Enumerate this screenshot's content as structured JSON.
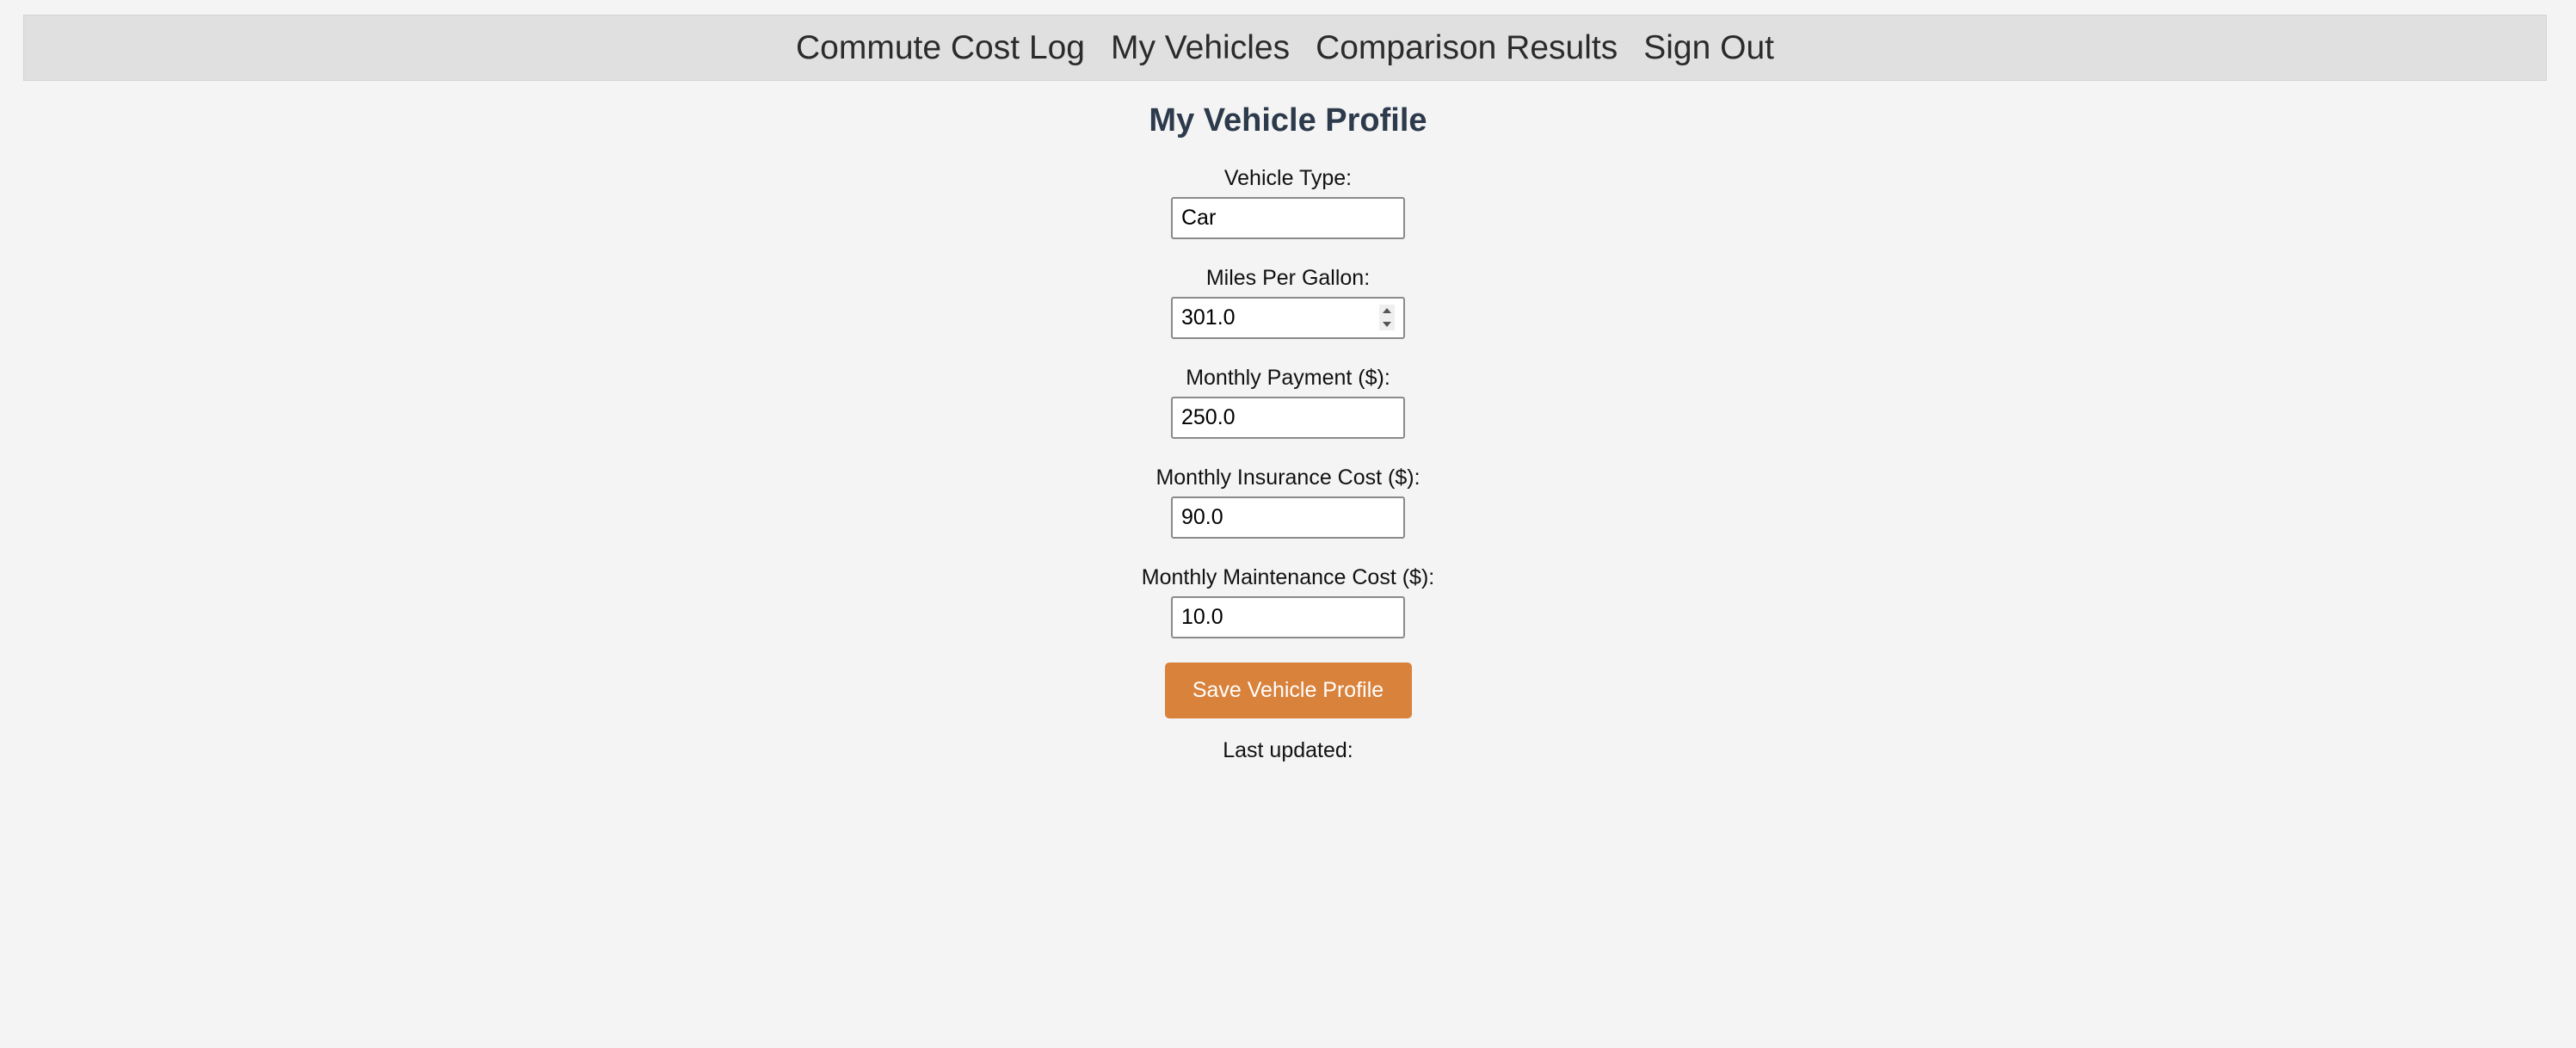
{
  "nav": {
    "items": [
      {
        "label": "Commute Cost Log"
      },
      {
        "label": "My Vehicles"
      },
      {
        "label": "Comparison Results"
      },
      {
        "label": "Sign Out"
      }
    ]
  },
  "page": {
    "title": "My Vehicle Profile"
  },
  "form": {
    "vehicle_type": {
      "label": "Vehicle Type:",
      "value": "Car"
    },
    "mpg": {
      "label": "Miles Per Gallon:",
      "value": "301.0"
    },
    "monthly_payment": {
      "label": "Monthly Payment ($):",
      "value": "250.0"
    },
    "monthly_insurance": {
      "label": "Monthly Insurance Cost ($):",
      "value": "90.0"
    },
    "monthly_maintenance": {
      "label": "Monthly Maintenance Cost ($):",
      "value": "10.0"
    },
    "save_label": "Save Vehicle Profile"
  },
  "status": {
    "last_updated_label": "Last updated:"
  },
  "colors": {
    "accent_button": "#d9823b",
    "title": "#2c3a4b",
    "nav_background": "#e0e0e0",
    "page_background": "#f4f4f4"
  }
}
